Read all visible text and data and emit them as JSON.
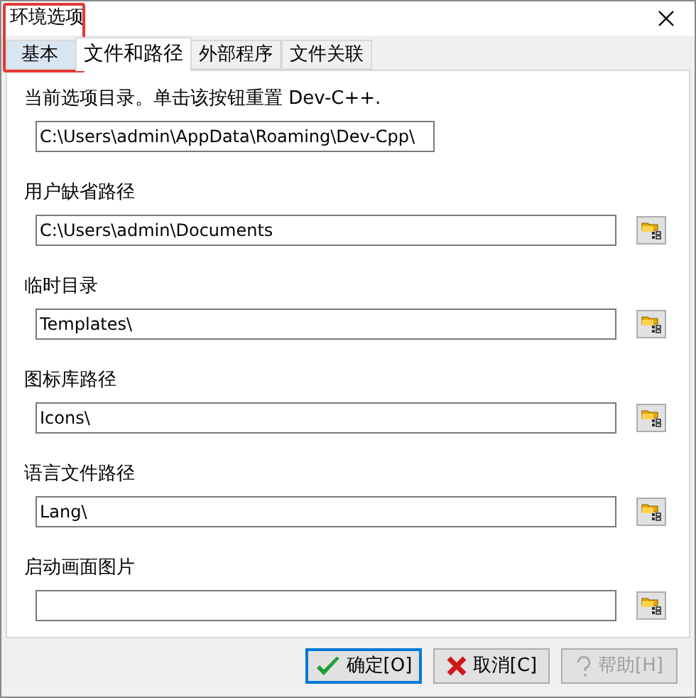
{
  "window": {
    "title": "环境选项"
  },
  "tabs": [
    {
      "label": "基本",
      "selected": false,
      "hovered": true
    },
    {
      "label": "文件和路径",
      "selected": true,
      "hovered": false
    },
    {
      "label": "外部程序",
      "selected": false,
      "hovered": false
    },
    {
      "label": "文件关联",
      "selected": false,
      "hovered": false
    }
  ],
  "intro": "当前选项目录。单击该按钮重置 Dev-C++.",
  "fields": [
    {
      "kind": "reset",
      "value": "C:\\Users\\admin\\AppData\\Roaming\\Dev-Cpp\\"
    },
    {
      "kind": "path",
      "label": "用户缺省路径",
      "value": "C:\\Users\\admin\\Documents"
    },
    {
      "kind": "path",
      "label": "临时目录",
      "value": "Templates\\"
    },
    {
      "kind": "path",
      "label": "图标库路径",
      "value": "Icons\\"
    },
    {
      "kind": "path",
      "label": "语言文件路径",
      "value": "Lang\\"
    },
    {
      "kind": "path",
      "label": "启动画面图片"
    }
  ],
  "buttons": [
    {
      "kind": "ok",
      "label": "确定[O]",
      "default": true,
      "disabled": false
    },
    {
      "kind": "cancel",
      "label": "取消[C]",
      "default": false,
      "disabled": false
    },
    {
      "kind": "help",
      "label": "帮助[H]",
      "default": false,
      "disabled": true
    }
  ]
}
